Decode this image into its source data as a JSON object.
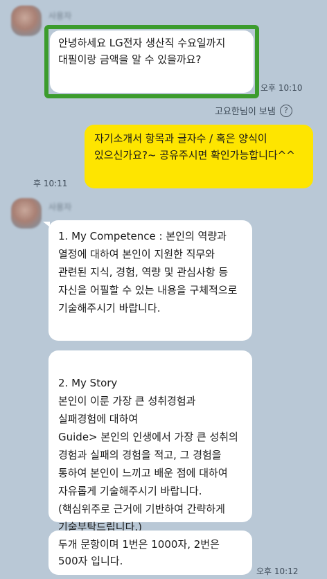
{
  "chat": {
    "sender_name": "사용자",
    "messages": [
      {
        "text": "안녕하세요 LG전자 생산직 수요일까지 대필이랑 금액을 알 수 있을까요?",
        "time": "오후 10:10"
      },
      {
        "sent_by": "고요한님이 보냄",
        "text": "자기소개서 항목과 글자수 / 혹은 양식이 있으신가요?~ 공유주시면 확인가능합니다^^",
        "time": "후 10:11"
      },
      {
        "text": "1. My Competence : 본인의 역량과 열정에 대하여 본인이 지원한 직무와 관련된 지식, 경험, 역량 및 관심사항 등 자신을 어필할 수 있는 내용을 구체적으로 기술해주시기 바랍니다."
      },
      {
        "text": "2. My Story\n본인이 이룬 가장 큰 성취경험과 실패경험에 대하여\nGuide> 본인의 인생에서 가장 큰 성취의 경험과 실패의 경험을 적고, 그 경험을 통하여 본인이 느끼고 배운 점에 대하여 자유롭게 기술해주시기 바랍니다. (핵심위주로 근거에 기반하여 간략하게 기술부탁드립니다.)"
      },
      {
        "text": "두개 문항이며 1번은 1000자, 2번은 500자 입니다.",
        "time": "오후 10:12"
      }
    ]
  }
}
